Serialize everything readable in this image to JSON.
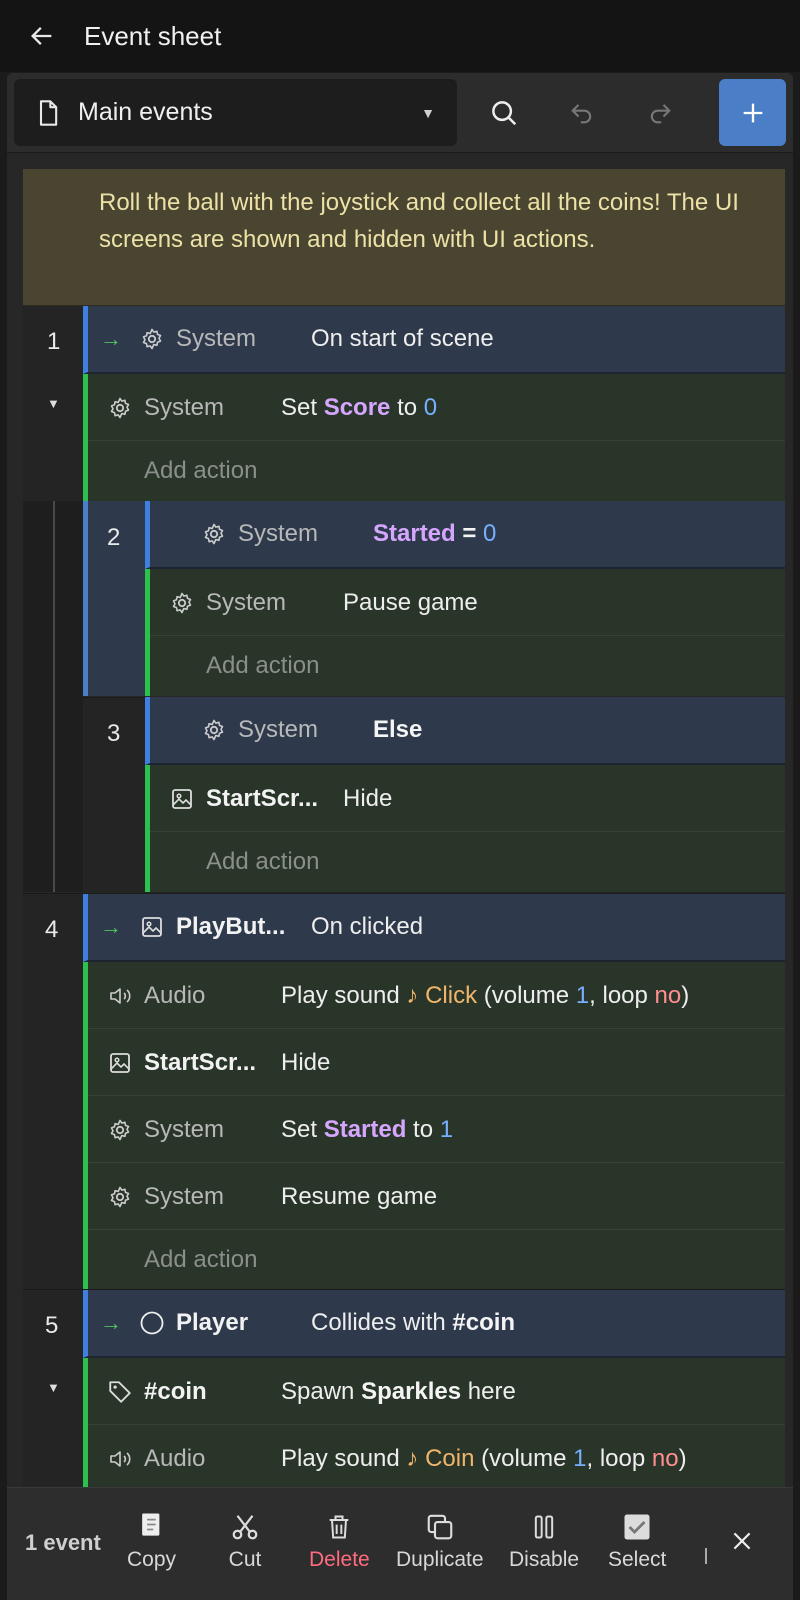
{
  "header": {
    "title": "Event sheet"
  },
  "toolbar": {
    "sheet_name": "Main events"
  },
  "comment": "Roll the ball with the joystick and collect all the coins! The UI screens are shown and hidden with UI actions.",
  "events": {
    "e1": {
      "num": "1",
      "cond_obj": "System",
      "cond_text": "On start of scene",
      "a1_obj": "System",
      "a1_pre": "Set ",
      "a1_var": "Score",
      "a1_mid": " to ",
      "a1_val": "0",
      "add": "Add action"
    },
    "e2": {
      "num": "2",
      "cond_obj": "System",
      "cond_var": "Started",
      "cond_op": " = ",
      "cond_val": "0",
      "a1_obj": "System",
      "a1_text": "Pause game",
      "add": "Add action"
    },
    "e3": {
      "num": "3",
      "cond_obj": "System",
      "cond_text": "Else",
      "a1_obj": "StartScr...",
      "a1_text": "Hide",
      "add": "Add action"
    },
    "e4": {
      "num": "4",
      "cond_obj": "PlayBut...",
      "cond_text": "On clicked",
      "a1_obj": "Audio",
      "a1_pre": "Play sound ",
      "a1_sound": "♪ Click",
      "a1_mid": " (volume ",
      "a1_vol": "1",
      "a1_mid2": ", loop ",
      "a1_loop": "no",
      "a1_end": ")",
      "a2_obj": "StartScr...",
      "a2_text": "Hide",
      "a3_obj": "System",
      "a3_pre": "Set ",
      "a3_var": "Started",
      "a3_mid": " to ",
      "a3_val": "1",
      "a4_obj": "System",
      "a4_text": "Resume game",
      "add": "Add action"
    },
    "e5": {
      "num": "5",
      "cond_obj": "Player",
      "cond_pre": "Collides with ",
      "cond_tag": "#coin",
      "a1_obj": "#coin",
      "a1_pre": "Spawn ",
      "a1_b": "Sparkles",
      "a1_end": " here",
      "a2_obj": "Audio",
      "a2_pre": "Play sound ",
      "a2_sound": "♪ Coin",
      "a2_mid": " (volume ",
      "a2_vol": "1",
      "a2_mid2": ", loop ",
      "a2_loop": "no",
      "a2_end": ")"
    }
  },
  "bottombar": {
    "count": "1 event",
    "copy": "Copy",
    "cut": "Cut",
    "delete": "Delete",
    "duplicate": "Duplicate",
    "disable": "Disable",
    "select": "Select"
  },
  "colors": {
    "accent": "#4a7fc7",
    "condition_bar": "#3f7fe0",
    "action_bar": "#2ec04e",
    "comment_bg": "#4a4530",
    "variable": "#d6a6ff",
    "number": "#76b0ff",
    "sound": "#f0b56a",
    "boolean_no": "#ff8f8f"
  }
}
